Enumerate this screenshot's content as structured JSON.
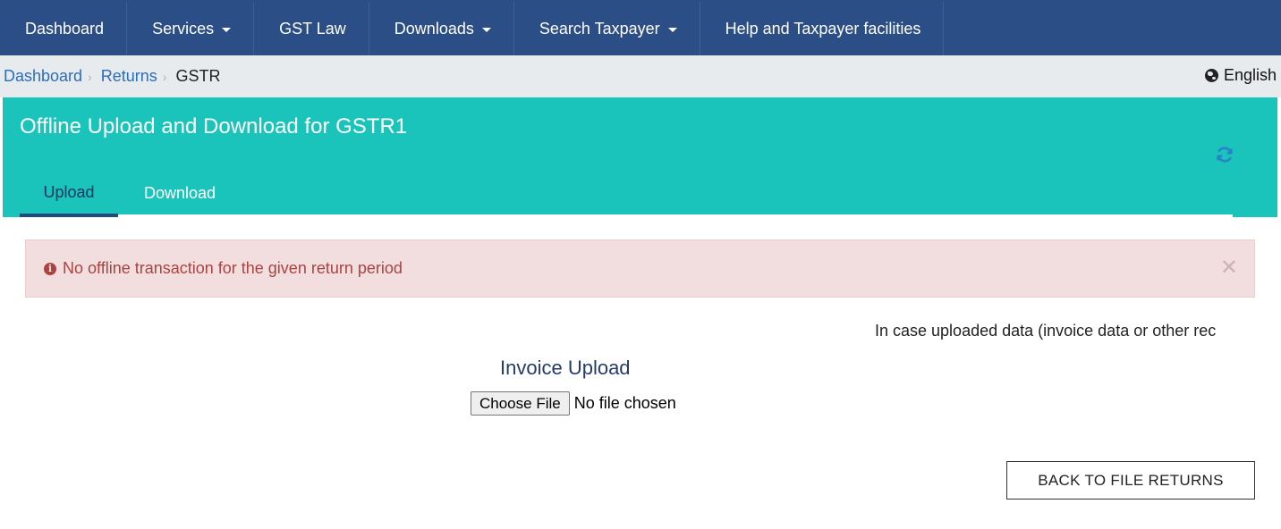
{
  "nav": {
    "items": [
      {
        "label": "Dashboard",
        "dropdown": false
      },
      {
        "label": "Services",
        "dropdown": true
      },
      {
        "label": "GST Law",
        "dropdown": false
      },
      {
        "label": "Downloads",
        "dropdown": true
      },
      {
        "label": "Search Taxpayer",
        "dropdown": true
      },
      {
        "label": "Help and Taxpayer facilities",
        "dropdown": false
      }
    ]
  },
  "breadcrumb": {
    "items": [
      "Dashboard",
      "Returns",
      "GSTR"
    ]
  },
  "language": {
    "label": "English",
    "icon": "globe-icon"
  },
  "header": {
    "title": "Offline Upload and Download for GSTR1",
    "refresh_icon": "refresh-icon",
    "tabs": [
      "Upload",
      "Download"
    ],
    "active_tab": "Upload"
  },
  "alert": {
    "icon": "info-circle-icon",
    "message": "No offline transaction for the given return period",
    "close_icon": "close-icon"
  },
  "note": {
    "text": "In case uploaded data (invoice data or other rec"
  },
  "upload": {
    "title": "Invoice Upload",
    "choose_label": "Choose File",
    "file_status": "No file chosen"
  },
  "actions": {
    "back_label": "BACK TO FILE RETURNS"
  },
  "colors": {
    "nav_bg": "#2c4e86",
    "header_bg": "#1bc4bb",
    "alert_bg": "#f2dede",
    "alert_text": "#a94442",
    "link": "#2a6ebb"
  }
}
